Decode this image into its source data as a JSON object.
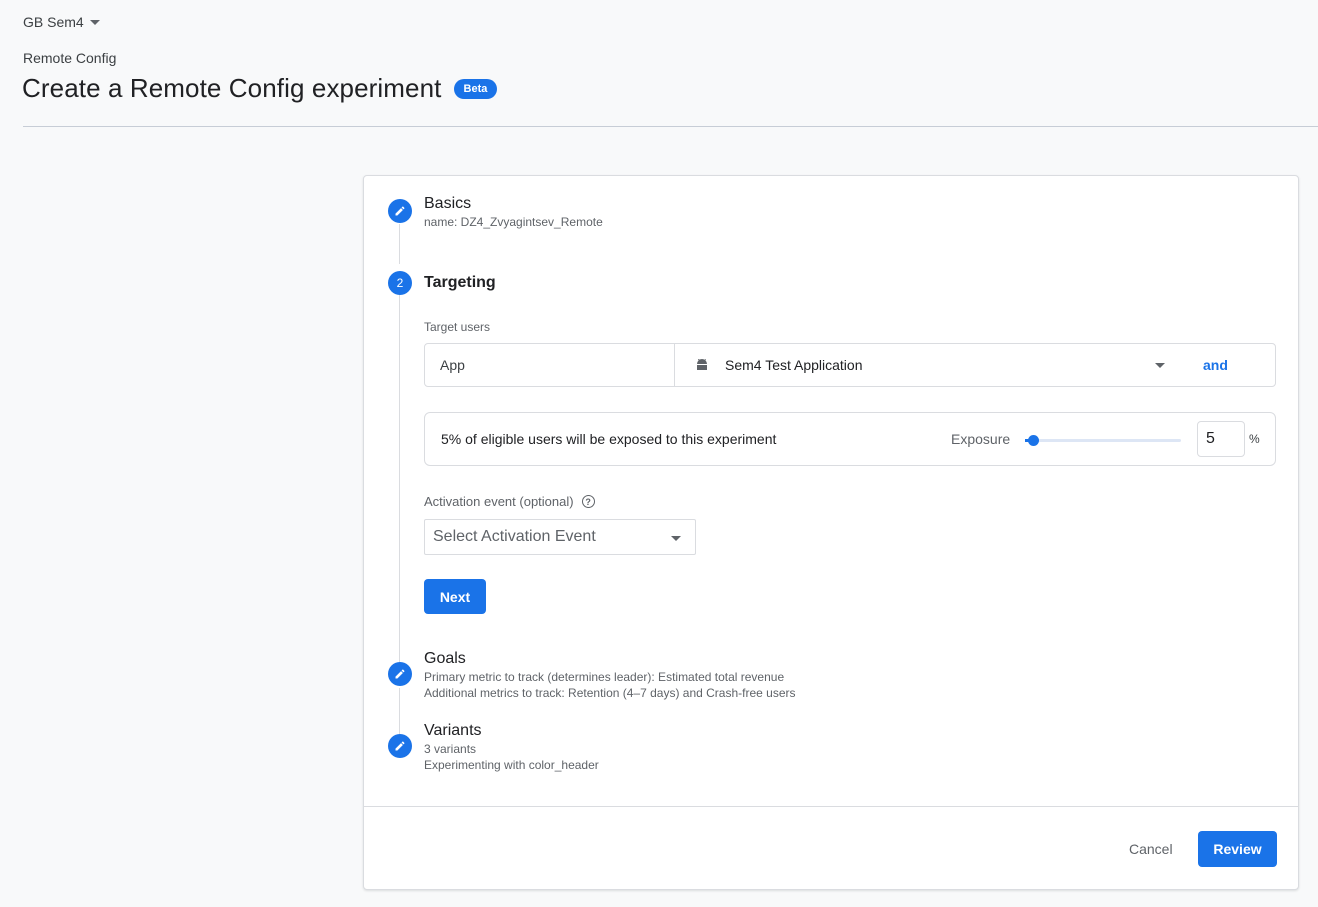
{
  "project": {
    "name": "GB Sem4"
  },
  "breadcrumb": "Remote Config",
  "page": {
    "title": "Create a Remote Config experiment",
    "badge": "Beta"
  },
  "steps": {
    "basics": {
      "title": "Basics",
      "summary": "name: DZ4_Zvyagintsev_Remote"
    },
    "targeting": {
      "number": "2",
      "title": "Targeting",
      "target_users_label": "Target users",
      "condition": {
        "field": "App",
        "value": "Sem4 Test Application",
        "and_label": "and"
      },
      "exposure": {
        "summary": "5% of eligible users will be exposed to this experiment",
        "label": "Exposure",
        "value": "5",
        "percent_sign": "%",
        "slider_fraction": 0.05
      },
      "activation": {
        "label": "Activation event (optional)",
        "placeholder": "Select Activation Event"
      },
      "next_label": "Next"
    },
    "goals": {
      "title": "Goals",
      "line1": "Primary metric to track (determines leader): Estimated total revenue",
      "line2": "Additional metrics to track: Retention (4–7 days) and Crash-free users"
    },
    "variants": {
      "title": "Variants",
      "line1": "3 variants",
      "line2": "Experimenting with color_header"
    }
  },
  "footer": {
    "cancel_label": "Cancel",
    "review_label": "Review"
  },
  "colors": {
    "accent": "#1a73e8",
    "background": "#f8f9fa"
  },
  "icons": [
    "chevron-down-icon",
    "edit-pencil-icon",
    "android-icon",
    "help-icon"
  ]
}
